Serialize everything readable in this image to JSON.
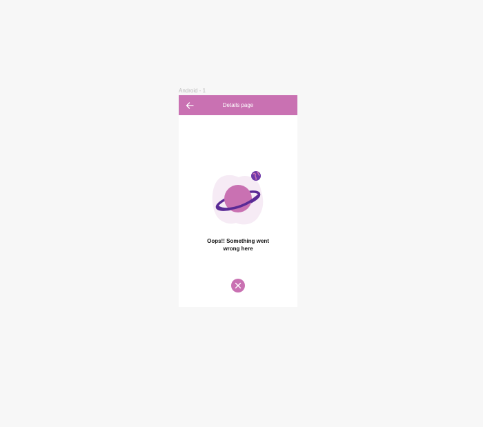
{
  "canvas": {
    "frame_label": "Android - 1"
  },
  "appbar": {
    "title": "Details page",
    "back_icon": "arrow-left-icon",
    "color": "#c971b2"
  },
  "error": {
    "message": "Oops!! Something went wrong here",
    "illustration": "planet-icon",
    "accent": "#5a2a96"
  },
  "close_button": {
    "icon": "close-icon",
    "color": "#c971b2"
  }
}
